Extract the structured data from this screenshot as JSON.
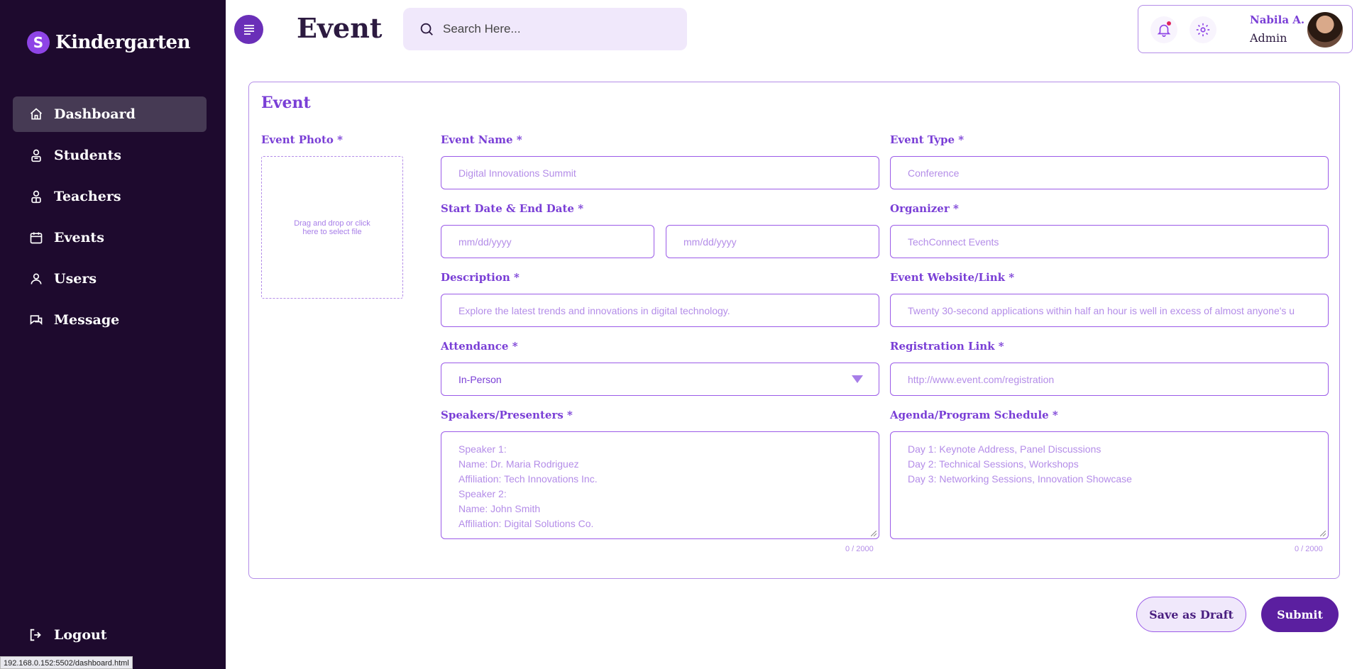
{
  "brand": {
    "name": "Kindergarten",
    "logo_letter": "S"
  },
  "nav": {
    "items": [
      {
        "label": "Dashboard",
        "icon": "home-icon",
        "active": true
      },
      {
        "label": "Students",
        "icon": "student-icon",
        "active": false
      },
      {
        "label": "Teachers",
        "icon": "teacher-icon",
        "active": false
      },
      {
        "label": "Events",
        "icon": "calendar-icon",
        "active": false
      },
      {
        "label": "Users",
        "icon": "user-icon",
        "active": false
      },
      {
        "label": "Message",
        "icon": "message-icon",
        "active": false
      }
    ],
    "logout_label": "Logout"
  },
  "status_url": "192.168.0.152:5502/dashboard.html",
  "header": {
    "title": "Event",
    "search_placeholder": "Search Here...",
    "user_name": "Nabila A.",
    "user_role": "Admin"
  },
  "form": {
    "title": "Event",
    "photo_label": "Event Photo *",
    "photo_hint": "Drag and drop or click here to select file",
    "event_name_label": "Event Name *",
    "event_name_value": "Digital Innovations Summit",
    "event_type_label": "Event Type *",
    "event_type_value": "Conference",
    "dates_label": "Start Date & End Date *",
    "start_date_placeholder": "mm/dd/yyyy",
    "end_date_placeholder": "mm/dd/yyyy",
    "organizer_label": "Organizer *",
    "organizer_value": "TechConnect Events",
    "description_label": "Description *",
    "description_value": "Explore the latest trends and innovations in digital technology.",
    "website_label": "Event Website/Link *",
    "website_value": "Twenty 30-second applications within half an hour is well in excess of almost anyone's u",
    "attendance_label": "Attendance *",
    "attendance_value": "In-Person",
    "registration_label": "Registration Link *",
    "registration_value": "http://www.event.com/registration",
    "speakers_label": "Speakers/Presenters *",
    "speakers_lines": [
      "Speaker 1:",
      "Name: Dr. Maria Rodriguez",
      "Affiliation: Tech Innovations Inc.",
      "Speaker 2:",
      "Name: John Smith",
      "Affiliation: Digital Solutions Co."
    ],
    "speakers_counter": "0 / 2000",
    "agenda_label": "Agenda/Program Schedule *",
    "agenda_lines": [
      "Day 1: Keynote Address, Panel Discussions",
      "Day 2: Technical Sessions, Workshops",
      "Day 3: Networking Sessions, Innovation Showcase"
    ],
    "agenda_counter": "0 / 2000"
  },
  "actions": {
    "draft_label": "Save as Draft",
    "submit_label": "Submit"
  },
  "colors": {
    "sidebar_bg": "#1e0a2e",
    "accent": "#7a3fd6",
    "primary_button": "#5b1fa0"
  }
}
